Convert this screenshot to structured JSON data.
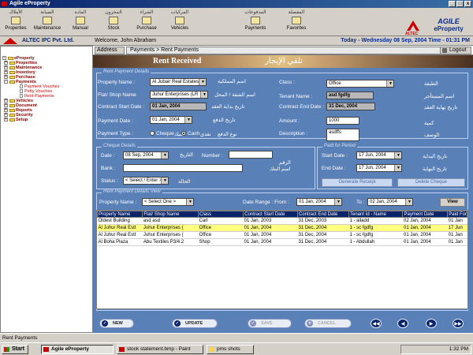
{
  "window": {
    "title": "Agile eProperty"
  },
  "toolbar": {
    "items": [
      {
        "label": "Properties",
        "ar": "الأملاك",
        "icon": "properties-icon"
      },
      {
        "label": "Maintenance",
        "ar": "الصيانة",
        "icon": "maintenance-icon"
      },
      {
        "label": "Manual",
        "ar": "المادة",
        "icon": "manual-icon"
      },
      {
        "label": "Stock",
        "ar": "المخزون",
        "icon": "stock-icon"
      },
      {
        "label": "Purchase",
        "ar": "الشراء",
        "icon": "purchase-icon"
      },
      {
        "label": "Vehicles",
        "ar": "المركبات",
        "icon": "vehicles-icon"
      },
      {
        "label": "Payments",
        "ar": "المدفوعات",
        "icon": "payments-icon"
      },
      {
        "label": "Favorites",
        "ar": "المفضلة",
        "icon": "favorites-icon"
      }
    ],
    "logo_small": "ALTEC",
    "logo_a": "AGILE",
    "logo_b": "eProperty"
  },
  "infobar": {
    "company": "ALTEC IPC Pvt. Ltd.",
    "welcome": "Welcome, John Abraham",
    "datetime": "Today - Wednesday 08 Sep, 2004  Time - 01:31 PM"
  },
  "address": {
    "label": "Address",
    "value": "Payments > Rent Payments",
    "logout": "Logout"
  },
  "tree": [
    {
      "label": "eProperty",
      "level": "root"
    },
    {
      "label": "Properties",
      "level": "l1"
    },
    {
      "label": "Maintenance",
      "level": "l1"
    },
    {
      "label": "Inventory",
      "level": "l1"
    },
    {
      "label": "Purchase",
      "level": "l1"
    },
    {
      "label": "Payments",
      "level": "l1"
    },
    {
      "label": "Payment Vouches",
      "level": "l2"
    },
    {
      "label": "Petty Vouches",
      "level": "l2"
    },
    {
      "label": "Rent Payments",
      "level": "l2"
    },
    {
      "label": "Vehicles",
      "level": "l1"
    },
    {
      "label": "Document",
      "level": "l1"
    },
    {
      "label": "Reports",
      "level": "l1"
    },
    {
      "label": "Security",
      "level": "l1"
    },
    {
      "label": "Setup",
      "level": "l1"
    }
  ],
  "banner": {
    "en": "Rent Received",
    "ar": "تلقي الإيجار"
  },
  "rent": {
    "legend": "Rent Payment Details",
    "property_name_label": "Property Name :",
    "property_name_value": "Al Jubair Real Estates",
    "property_name_ar": "اسم المملكية",
    "class_label": "Class :",
    "class_value": "Office",
    "class_ar": "الطبقة",
    "flat_label": "Flat/ Shop Name",
    "flat_value": "Juhur Enterprises (LR",
    "flat_ar": "اسم الشقة / المحل",
    "tenant_label": "Tenant Name :",
    "tenant_value": "asd fgdfg",
    "tenant_ar": "اسم المستأجر",
    "cstart_label": "Contract Start Date :",
    "cstart_value": "01 Jan, 2004",
    "cstart_ar": "تاريخ بداية العقد",
    "cend_label": "Contract End Date :",
    "cend_value": "31 Dec, 2004",
    "cend_ar": "تاريخ نهاية العقد",
    "paydate_label": "Payment Date :",
    "paydate_value": "01 Jan, 2004",
    "paydate_ar": "تاريخ الدفع",
    "amount_label": "Amount :",
    "amount_value": "1000",
    "amount_ar": "كمية",
    "paytype_label": "Payment Type :",
    "cheque_label": "Cheque",
    "cash_label": "Cash",
    "cash_ar": "نقدي",
    "cheque_ar": "شيك",
    "paytype_ar": "نوع الدفع",
    "desc_label": "Description :",
    "desc_value": "asdffs",
    "desc_ar": "الوصف"
  },
  "cheque": {
    "legend": "Cheque Details",
    "date_label": "Date :",
    "date_value": "08 Sep, 2004",
    "date_ar": "التاريخ",
    "number_label": "Number :",
    "number_value": "",
    "number_ar": "الرقم",
    "bank_label": "Bank :",
    "bank_value": "",
    "bank_ar": "اسم البنك",
    "status_label": "Status :",
    "status_value": "< Select / Enter >",
    "status_ar": "الحالة"
  },
  "period": {
    "legend": "Paid for Period",
    "start_label": "Start Date :",
    "start_value": "17 Jun, 2004",
    "start_ar": "تاريخ البداية",
    "end_label": "End Date :",
    "end_value": "17 Jun, 2004",
    "end_ar": "تاريخ النهاية",
    "generate": "Generate Receipt",
    "delete": "Delete Cheque"
  },
  "view": {
    "legend": "Rent Payment Details View",
    "property_label": "Property Name :",
    "property_value": "< Select One >",
    "range_label": "Date Range : From :",
    "from_value": "01 Jan, 2004",
    "to_label": "To :",
    "to_value": "02 Jan, 2004",
    "view_btn": "View",
    "columns": [
      "Property Name",
      "Flat/ Shop Name",
      "Class",
      "Contract Start Date",
      "Contract End Date",
      "Tenant Id - Name",
      "Payment Date",
      "Paid For"
    ],
    "rows": [
      [
        "Oldest Building",
        "asd asd",
        "Carl",
        "01 Jan, 2003",
        "31 Dec, 2003",
        "1 - alladd",
        "02 Jan, 2004",
        "01 Jan"
      ],
      [
        "Al Juhur Real Estt",
        "Juhur Enterprises (",
        "Office",
        "01 Jan, 2004",
        "31 Dec, 2004",
        "1 - sc fgdfg",
        "01 Jan, 2004",
        "17 Jun"
      ],
      [
        "Al Juhur Real Estt",
        "Juhur Enterprises (",
        "Office",
        "01 Jan, 2004",
        "31 Dec, 2004",
        "1 - sc fgdfg",
        "01 Jan, 2004",
        "01 Jan"
      ],
      [
        "Al Boha Plaza",
        "Abu Textiles P3/4.2",
        "Shop",
        "01 Jan, 2004",
        "31 Dec, 2004",
        "1 - Abdullah",
        "01 Jan, 2004",
        "01 Jan"
      ]
    ]
  },
  "actions": {
    "new": "NEW",
    "update": "UPDATE",
    "save": "SAVE",
    "cancel": "CANCEL"
  },
  "status": {
    "text": "Rent Payments"
  },
  "taskbar": {
    "start": "Start",
    "tasks": [
      "Agile eProperty",
      "stock statement.bmp - Paint",
      "pms shots"
    ],
    "time": "1:32 PM"
  }
}
